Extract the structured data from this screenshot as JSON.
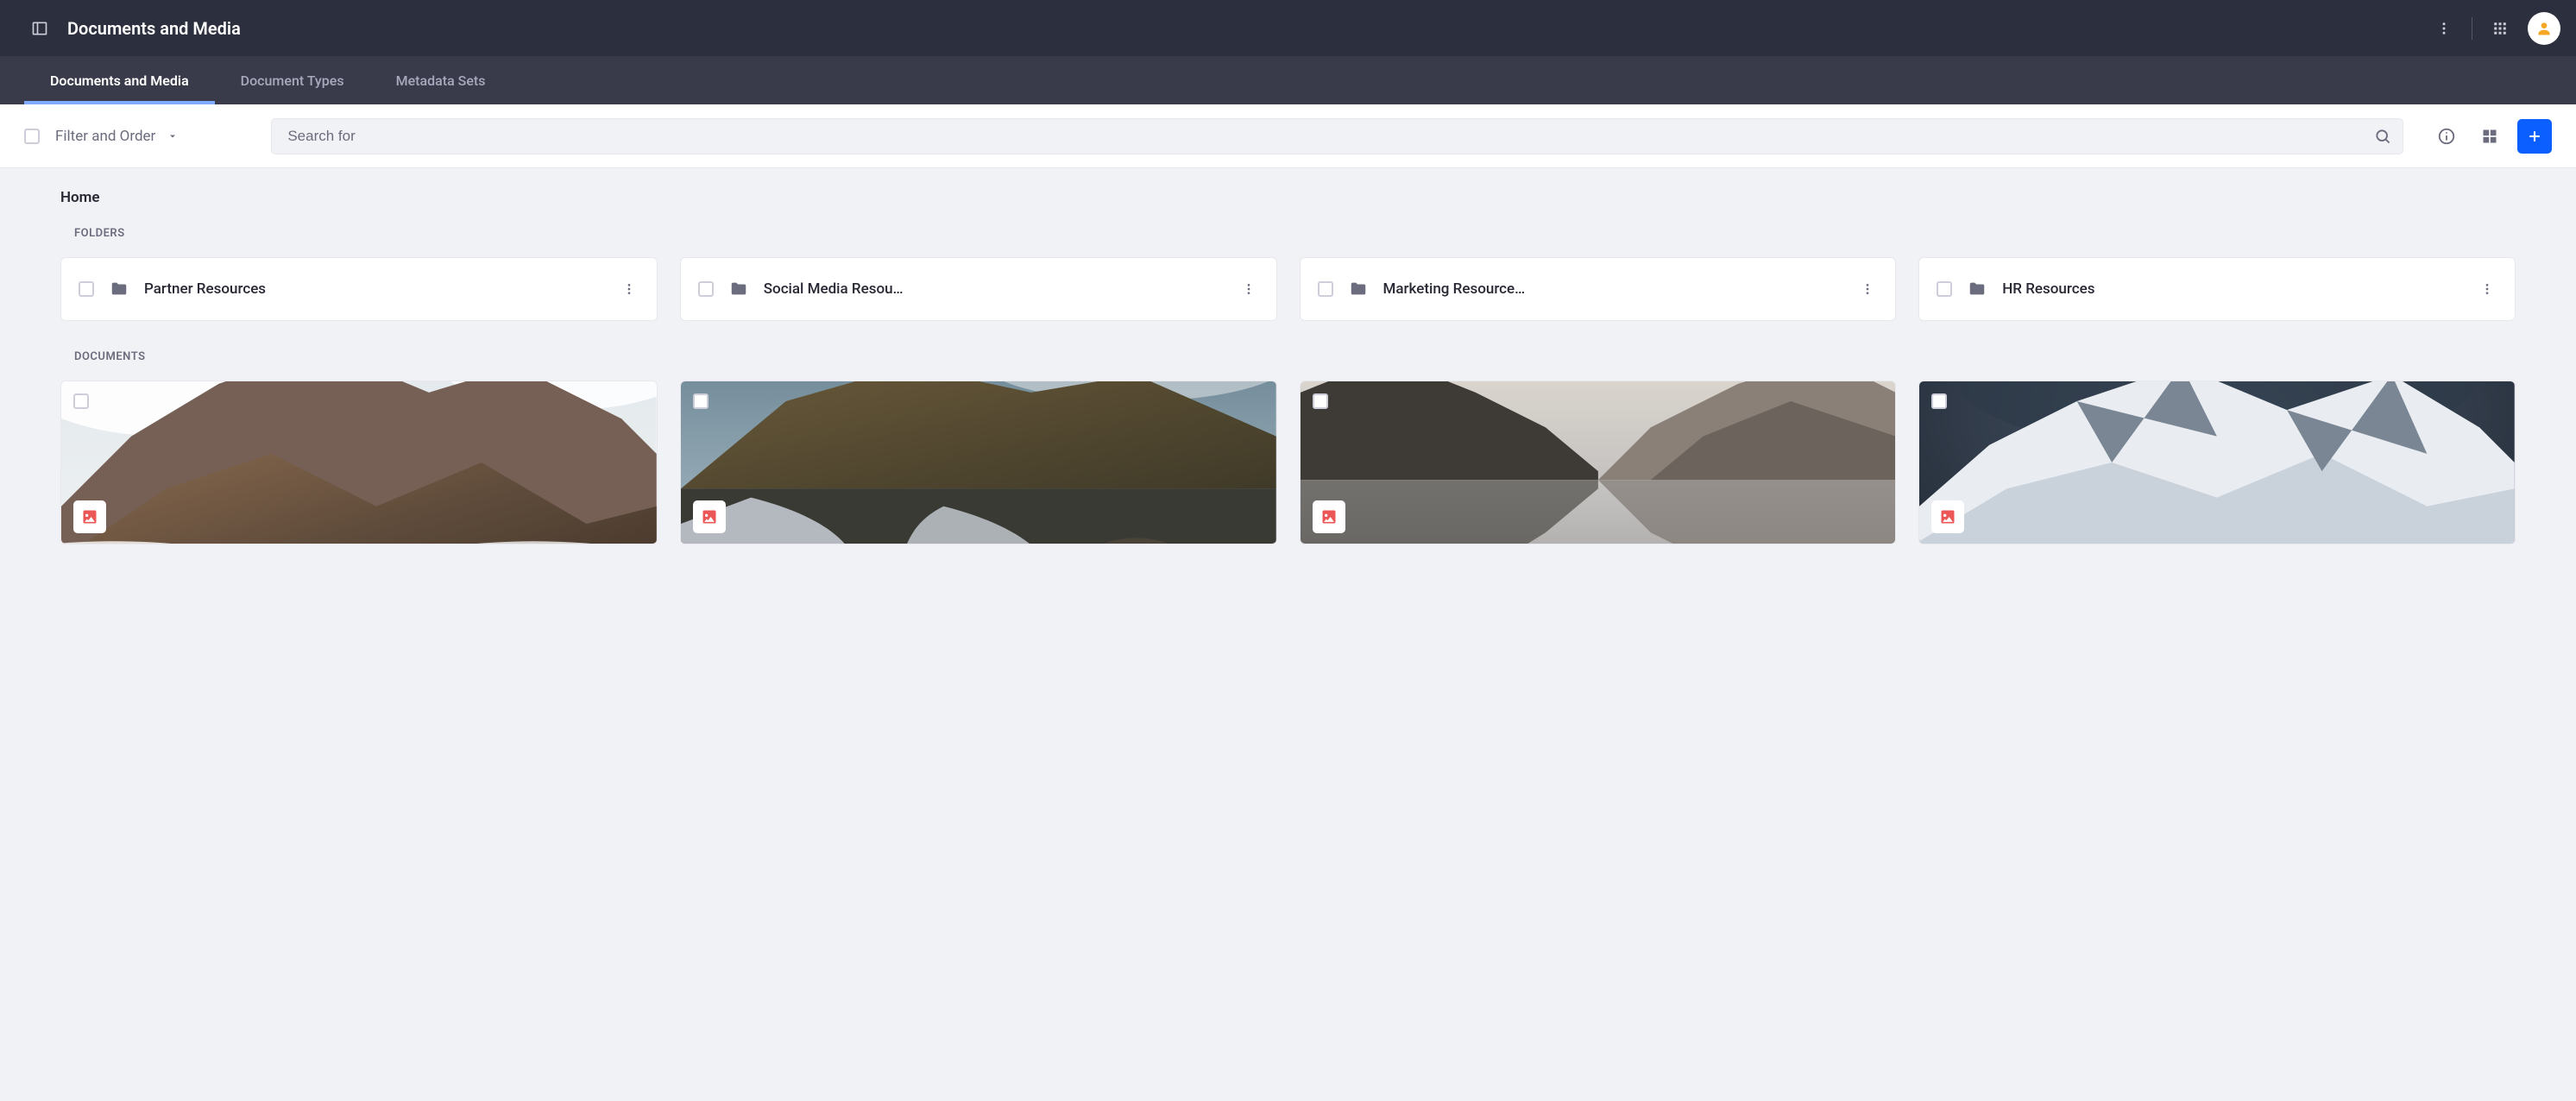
{
  "header": {
    "title": "Documents and Media"
  },
  "tabs": [
    {
      "label": "Documents and Media",
      "active": true
    },
    {
      "label": "Document Types",
      "active": false
    },
    {
      "label": "Metadata Sets",
      "active": false
    }
  ],
  "toolbar": {
    "filter_label": "Filter and Order",
    "search_placeholder": "Search for"
  },
  "breadcrumb": "Home",
  "sections": {
    "folders_label": "FOLDERS",
    "documents_label": "DOCUMENTS"
  },
  "folders": [
    {
      "name": "Partner Resources"
    },
    {
      "name": "Social Media Resou…"
    },
    {
      "name": "Marketing Resource…"
    },
    {
      "name": "HR Resources"
    }
  ],
  "documents": [
    {
      "thumb": "mountain-clouds"
    },
    {
      "thumb": "river-rocks"
    },
    {
      "thumb": "lake-hills"
    },
    {
      "thumb": "snow-peaks"
    }
  ],
  "colors": {
    "primary": "#0b5fff",
    "folder_icon": "#6b6c7e",
    "image_badge": "#eb5757"
  }
}
